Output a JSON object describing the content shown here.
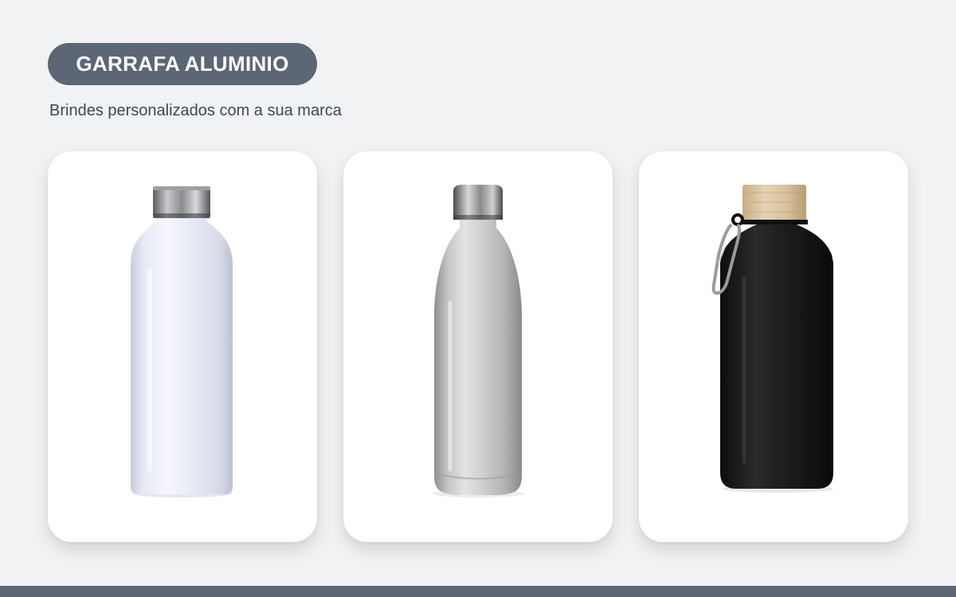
{
  "header": {
    "title": "GARRAFA ALUMINIO",
    "subtitle": "Brindes personalizados com a sua marca"
  },
  "products": [
    {
      "image": "white-aluminum-bottle-steel-cap",
      "body_color": "#eceef8",
      "cap_color": "#8a8c90"
    },
    {
      "image": "silver-cola-shaped-bottle",
      "body_color": "#c9c9c9",
      "cap_color": "#9a9a9a"
    },
    {
      "image": "black-bottle-bamboo-cap-carabiner",
      "body_color": "#1c1c1c",
      "cap_color": "#d8c2a0"
    }
  ],
  "colors": {
    "background": "#f1f2f4",
    "accent": "#5d6675",
    "subtitle_text": "#3f4756"
  }
}
